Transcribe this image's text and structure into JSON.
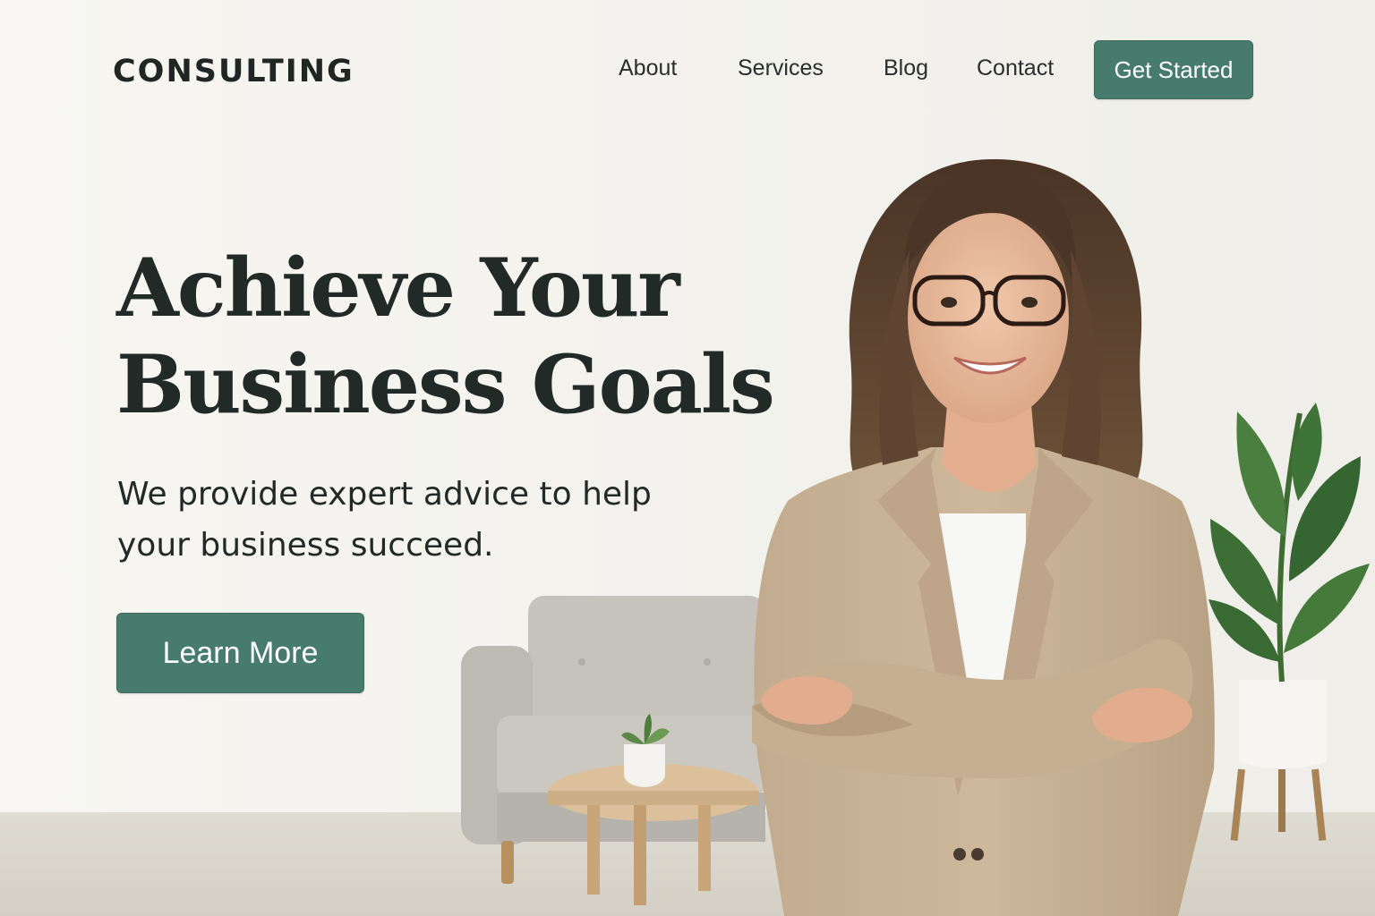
{
  "colors": {
    "accent": "#477b6c",
    "text_dark": "#222a28",
    "page_background": "#f6f5f1"
  },
  "nav": {
    "logo": "CONSULTING",
    "links": [
      "About",
      "Services",
      "Blog",
      "Contact"
    ],
    "cta_label": "Get Started"
  },
  "hero": {
    "title_lines": [
      "Achieve Your",
      "Business Goals"
    ],
    "subtitle_lines": [
      "We provide expert advice to help",
      "your business succeed."
    ],
    "button_label": "Learn More"
  }
}
